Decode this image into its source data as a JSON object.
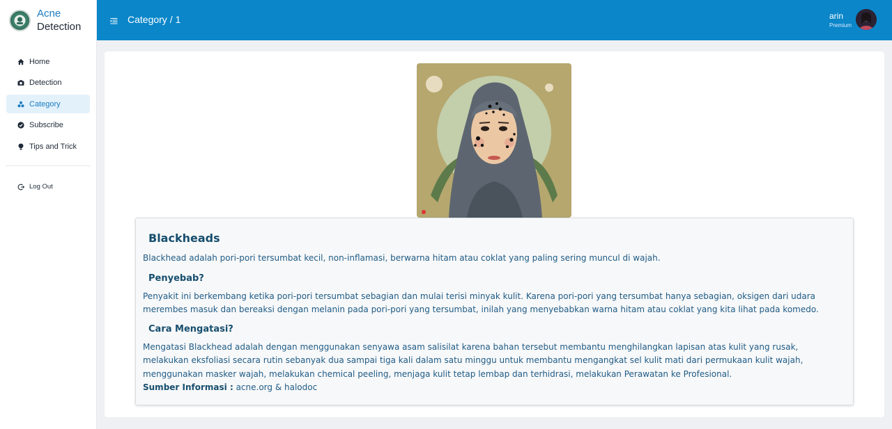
{
  "app": {
    "name_line1": "Acne",
    "name_line2": "Detection"
  },
  "sidebar": {
    "items": [
      {
        "label": "Home",
        "icon": "home-icon"
      },
      {
        "label": "Detection",
        "icon": "camera-icon"
      },
      {
        "label": "Category",
        "icon": "category-icon",
        "active": true
      },
      {
        "label": "Subscribe",
        "icon": "subscribe-icon"
      },
      {
        "label": "Tips and Trick",
        "icon": "bulb-icon"
      }
    ],
    "logout_label": "Log Out"
  },
  "header": {
    "breadcrumb": "Category / 1",
    "user_name": "arin",
    "user_plan": "Premium"
  },
  "article": {
    "title": "Blackheads",
    "intro": "Blackhead adalah pori-pori tersumbat kecil, non-inflamasi, berwarna hitam atau coklat yang paling sering muncul di wajah.",
    "cause_heading": "Penyebab?",
    "cause_text": "Penyakit ini berkembang ketika pori-pori tersumbat sebagian dan mulai terisi minyak kulit. Karena pori-pori yang tersumbat hanya sebagian, oksigen dari udara merembes masuk dan bereaksi dengan melanin pada pori-pori yang tersumbat, inilah yang menyebabkan warna hitam atau coklat yang kita lihat pada komedo.",
    "treatment_heading": "Cara Mengatasi?",
    "treatment_text": "Mengatasi Blackhead adalah dengan menggunakan senyawa asam salisilat karena bahan tersebut membantu menghilangkan lapisan atas kulit yang rusak, melakukan eksfoliasi secara rutin sebanyak dua sampai tiga kali dalam satu minggu untuk membantu mengangkat sel kulit mati dari permukaan kulit wajah, menggunakan masker wajah, melakukan chemical peeling, menjaga kulit tetap lembap dan terhidrasi, melakukan Perawatan ke Profesional.",
    "source_label": "Sumber Informasi :",
    "source_value": "acne.org & halodoc"
  },
  "colors": {
    "header": "#0a86c9",
    "accent": "#1a7cc1",
    "heading": "#164e6e",
    "body_text": "#1f5b86"
  }
}
